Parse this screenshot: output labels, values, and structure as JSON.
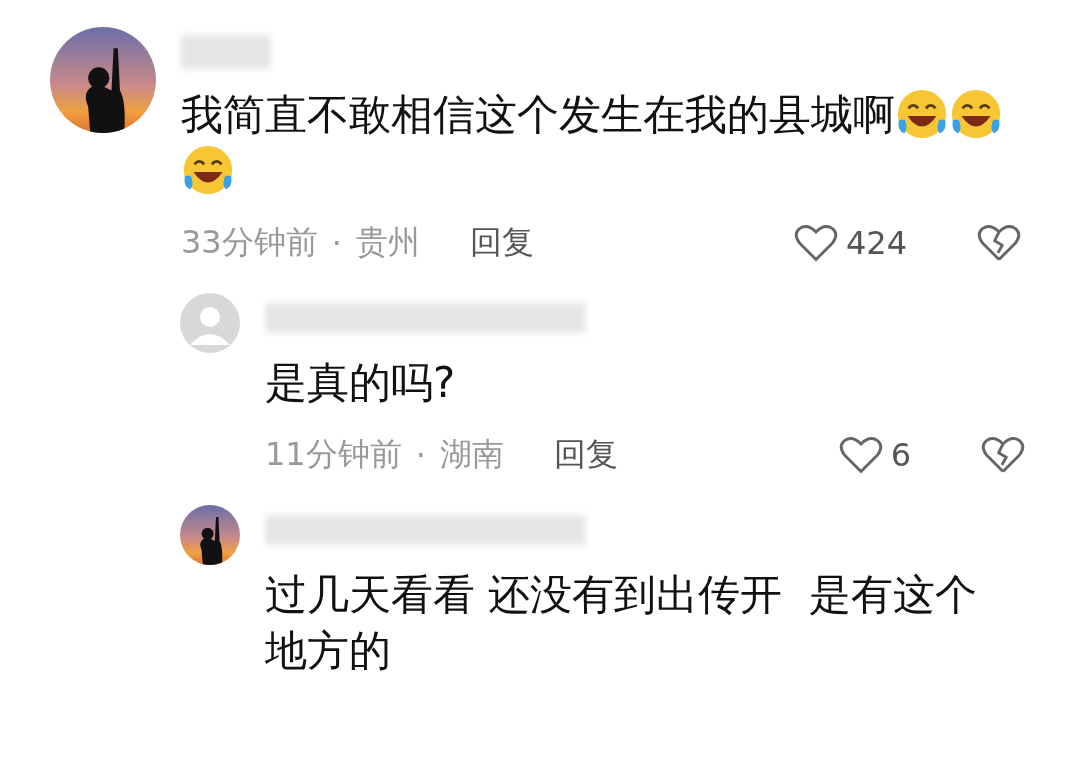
{
  "comments": [
    {
      "avatar": {
        "kind": "photo"
      },
      "text": "我简直不敢相信这个发生在我的县城啊",
      "emojis": [
        {
          "kind": "laugh-cry"
        },
        {
          "kind": "laugh-cry"
        },
        {
          "kind": "laugh-cry"
        }
      ],
      "time": "33分钟前",
      "separator": "·",
      "location": "贵州",
      "reply_label": "回复",
      "likes": "424",
      "replies": [
        {
          "avatar": {
            "kind": "default"
          },
          "text": "是真的吗?",
          "time": "11分钟前",
          "separator": "·",
          "location": "湖南",
          "reply_label": "回复",
          "likes": "6"
        },
        {
          "avatar": {
            "kind": "photo"
          },
          "text": "过几天看看 还没有到出传开  是有这个地方的"
        }
      ]
    }
  ]
}
